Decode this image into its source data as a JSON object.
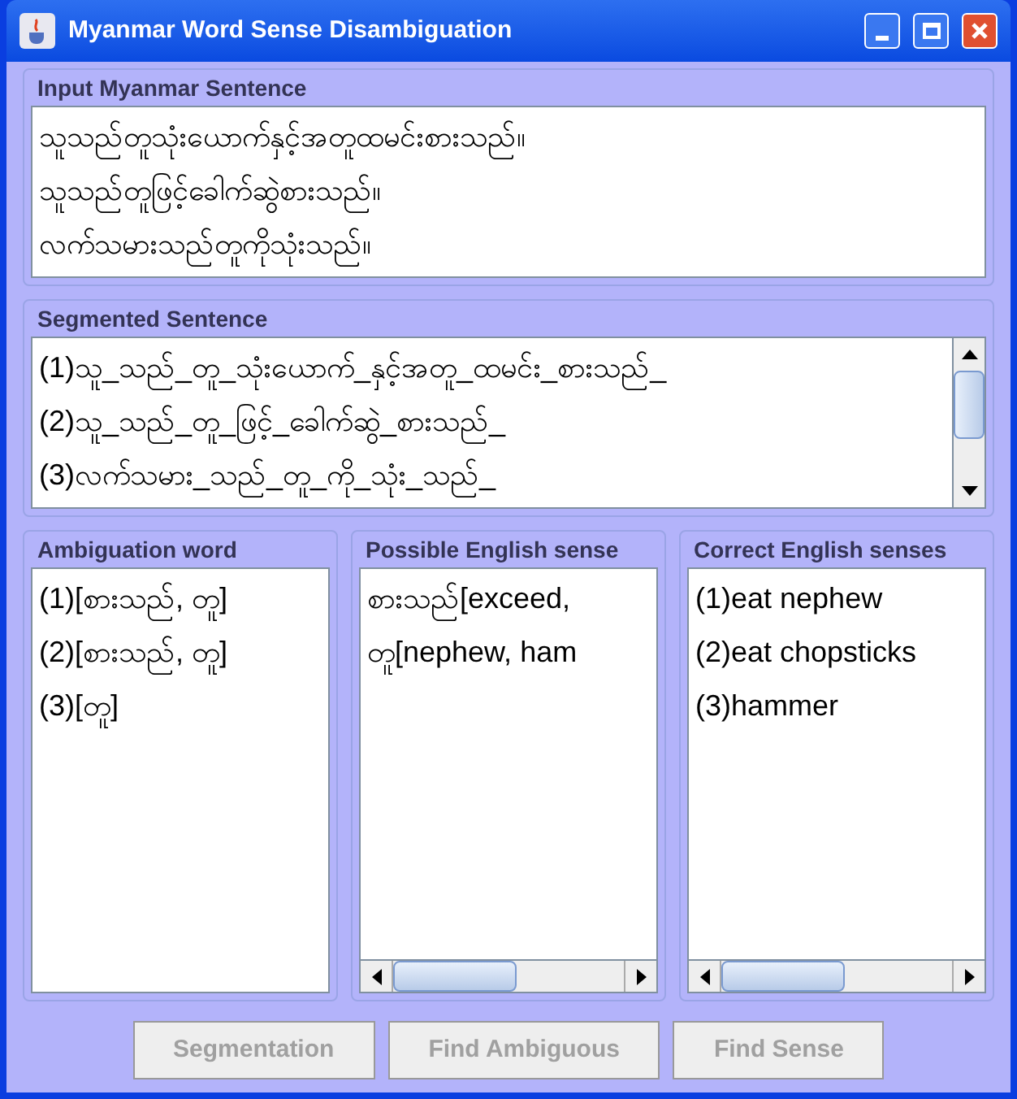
{
  "window": {
    "title": "Myanmar Word Sense Disambiguation"
  },
  "input_panel": {
    "title": "Input Myanmar Sentence",
    "lines": [
      "သူသည်တူသုံးယောက်နှင့်အတူထမင်းစားသည်။",
      "သူသည်တူဖြင့်ခေါက်ဆွဲစားသည်။",
      "လက်သမားသည်တူကိုသုံးသည်။"
    ]
  },
  "segmented_panel": {
    "title": "Segmented Sentence",
    "lines": [
      "(1)သူ_သည်_တူ_သုံးယောက်_နှင့်အတူ_ထမင်း_စားသည်_",
      "(2)သူ_သည်_တူ_ဖြင့်_ခေါက်ဆွဲ_စားသည်_",
      "(3)လက်သမား_သည်_တူ_ကို_သုံး_သည်_"
    ]
  },
  "lists": [
    {
      "title": "Ambiguation word",
      "items": [
        "(1)[စားသည်, တူ]",
        "(2)[စားသည်, တူ]",
        "(3)[တူ]"
      ],
      "horizontal_scroll": false
    },
    {
      "title": "Possible English sense",
      "items": [
        "စားသည်[exceed,",
        "တူ[nephew, ham"
      ],
      "horizontal_scroll": true
    },
    {
      "title": "Correct English senses",
      "items": [
        "(1)eat  nephew",
        "(2)eat  chopsticks",
        "(3)hammer"
      ],
      "horizontal_scroll": true
    }
  ],
  "buttons": [
    {
      "label": "Segmentation",
      "disabled": true
    },
    {
      "label": "Find Ambiguous",
      "disabled": true
    },
    {
      "label": "Find Sense",
      "disabled": true
    }
  ]
}
